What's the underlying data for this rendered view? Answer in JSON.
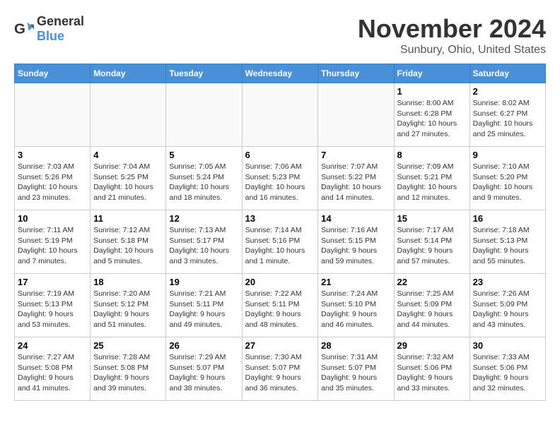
{
  "logo": {
    "general": "General",
    "blue": "Blue"
  },
  "header": {
    "month": "November 2024",
    "location": "Sunbury, Ohio, United States"
  },
  "weekdays": [
    "Sunday",
    "Monday",
    "Tuesday",
    "Wednesday",
    "Thursday",
    "Friday",
    "Saturday"
  ],
  "weeks": [
    [
      {
        "day": "",
        "info": ""
      },
      {
        "day": "",
        "info": ""
      },
      {
        "day": "",
        "info": ""
      },
      {
        "day": "",
        "info": ""
      },
      {
        "day": "",
        "info": ""
      },
      {
        "day": "1",
        "info": "Sunrise: 8:00 AM\nSunset: 6:28 PM\nDaylight: 10 hours and 27 minutes."
      },
      {
        "day": "2",
        "info": "Sunrise: 8:02 AM\nSunset: 6:27 PM\nDaylight: 10 hours and 25 minutes."
      }
    ],
    [
      {
        "day": "3",
        "info": "Sunrise: 7:03 AM\nSunset: 5:26 PM\nDaylight: 10 hours and 23 minutes."
      },
      {
        "day": "4",
        "info": "Sunrise: 7:04 AM\nSunset: 5:25 PM\nDaylight: 10 hours and 21 minutes."
      },
      {
        "day": "5",
        "info": "Sunrise: 7:05 AM\nSunset: 5:24 PM\nDaylight: 10 hours and 18 minutes."
      },
      {
        "day": "6",
        "info": "Sunrise: 7:06 AM\nSunset: 5:23 PM\nDaylight: 10 hours and 16 minutes."
      },
      {
        "day": "7",
        "info": "Sunrise: 7:07 AM\nSunset: 5:22 PM\nDaylight: 10 hours and 14 minutes."
      },
      {
        "day": "8",
        "info": "Sunrise: 7:09 AM\nSunset: 5:21 PM\nDaylight: 10 hours and 12 minutes."
      },
      {
        "day": "9",
        "info": "Sunrise: 7:10 AM\nSunset: 5:20 PM\nDaylight: 10 hours and 9 minutes."
      }
    ],
    [
      {
        "day": "10",
        "info": "Sunrise: 7:11 AM\nSunset: 5:19 PM\nDaylight: 10 hours and 7 minutes."
      },
      {
        "day": "11",
        "info": "Sunrise: 7:12 AM\nSunset: 5:18 PM\nDaylight: 10 hours and 5 minutes."
      },
      {
        "day": "12",
        "info": "Sunrise: 7:13 AM\nSunset: 5:17 PM\nDaylight: 10 hours and 3 minutes."
      },
      {
        "day": "13",
        "info": "Sunrise: 7:14 AM\nSunset: 5:16 PM\nDaylight: 10 hours and 1 minute."
      },
      {
        "day": "14",
        "info": "Sunrise: 7:16 AM\nSunset: 5:15 PM\nDaylight: 9 hours and 59 minutes."
      },
      {
        "day": "15",
        "info": "Sunrise: 7:17 AM\nSunset: 5:14 PM\nDaylight: 9 hours and 57 minutes."
      },
      {
        "day": "16",
        "info": "Sunrise: 7:18 AM\nSunset: 5:13 PM\nDaylight: 9 hours and 55 minutes."
      }
    ],
    [
      {
        "day": "17",
        "info": "Sunrise: 7:19 AM\nSunset: 5:13 PM\nDaylight: 9 hours and 53 minutes."
      },
      {
        "day": "18",
        "info": "Sunrise: 7:20 AM\nSunset: 5:12 PM\nDaylight: 9 hours and 51 minutes."
      },
      {
        "day": "19",
        "info": "Sunrise: 7:21 AM\nSunset: 5:11 PM\nDaylight: 9 hours and 49 minutes."
      },
      {
        "day": "20",
        "info": "Sunrise: 7:22 AM\nSunset: 5:11 PM\nDaylight: 9 hours and 48 minutes."
      },
      {
        "day": "21",
        "info": "Sunrise: 7:24 AM\nSunset: 5:10 PM\nDaylight: 9 hours and 46 minutes."
      },
      {
        "day": "22",
        "info": "Sunrise: 7:25 AM\nSunset: 5:09 PM\nDaylight: 9 hours and 44 minutes."
      },
      {
        "day": "23",
        "info": "Sunrise: 7:26 AM\nSunset: 5:09 PM\nDaylight: 9 hours and 43 minutes."
      }
    ],
    [
      {
        "day": "24",
        "info": "Sunrise: 7:27 AM\nSunset: 5:08 PM\nDaylight: 9 hours and 41 minutes."
      },
      {
        "day": "25",
        "info": "Sunrise: 7:28 AM\nSunset: 5:08 PM\nDaylight: 9 hours and 39 minutes."
      },
      {
        "day": "26",
        "info": "Sunrise: 7:29 AM\nSunset: 5:07 PM\nDaylight: 9 hours and 38 minutes."
      },
      {
        "day": "27",
        "info": "Sunrise: 7:30 AM\nSunset: 5:07 PM\nDaylight: 9 hours and 36 minutes."
      },
      {
        "day": "28",
        "info": "Sunrise: 7:31 AM\nSunset: 5:07 PM\nDaylight: 9 hours and 35 minutes."
      },
      {
        "day": "29",
        "info": "Sunrise: 7:32 AM\nSunset: 5:06 PM\nDaylight: 9 hours and 33 minutes."
      },
      {
        "day": "30",
        "info": "Sunrise: 7:33 AM\nSunset: 5:06 PM\nDaylight: 9 hours and 32 minutes."
      }
    ]
  ]
}
